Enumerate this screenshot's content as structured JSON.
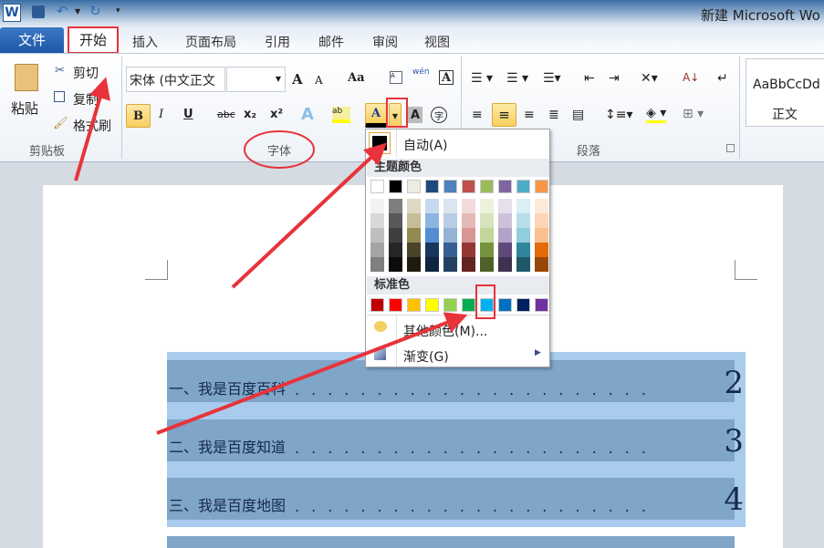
{
  "window": {
    "title": "新建 Microsoft Wo"
  },
  "qat": {
    "app_icon": "W"
  },
  "tabs": [
    {
      "label": "文件"
    },
    {
      "label": "开始"
    },
    {
      "label": "插入"
    },
    {
      "label": "页面布局"
    },
    {
      "label": "引用"
    },
    {
      "label": "邮件"
    },
    {
      "label": "审阅"
    },
    {
      "label": "视图"
    }
  ],
  "clipboard": {
    "paste": "粘贴",
    "cut": "剪切",
    "copy": "复制",
    "format_painter": "格式刷",
    "group": "剪贴板"
  },
  "font": {
    "name": "宋体 (中文正文",
    "size": "",
    "group": "字体",
    "bold": "B",
    "italic": "I",
    "underline": "U",
    "strike": "abc",
    "sub": "x₂",
    "sup": "x²",
    "grow": "A",
    "shrink": "A",
    "case": "Aa",
    "color_a": "A",
    "shade_a": "A",
    "enclose": "字",
    "phonetic": "wén",
    "border_a": "A"
  },
  "paragraph": {
    "group": "段落"
  },
  "styles": {
    "preview": "AaBbCcDd",
    "name": "正文"
  },
  "color_menu": {
    "auto": "自动(A)",
    "theme_header": "主题颜色",
    "standard_header": "标准色",
    "more": "其他颜色(M)...",
    "gradient": "渐变(G)",
    "theme_top": [
      "#ffffff",
      "#000000",
      "#eeece1",
      "#1f497d",
      "#4f81bd",
      "#c0504d",
      "#9bbb59",
      "#8064a2",
      "#4bacc6",
      "#f79646"
    ],
    "theme_shades": [
      [
        "#f2f2f2",
        "#7f7f7f",
        "#ddd9c3",
        "#c6d9f0",
        "#dbe5f1",
        "#f2dcdb",
        "#ebf1dd",
        "#e5e0ec",
        "#dbeef3",
        "#fdeada"
      ],
      [
        "#d8d8d8",
        "#595959",
        "#c4bd97",
        "#8db3e2",
        "#b8cce4",
        "#e5b9b7",
        "#d7e3bc",
        "#ccc1d9",
        "#b7dde8",
        "#fbd5b5"
      ],
      [
        "#bfbfbf",
        "#3f3f3f",
        "#938953",
        "#548dd4",
        "#95b3d7",
        "#d99694",
        "#c3d69b",
        "#b2a2c7",
        "#92cddc",
        "#fac08f"
      ],
      [
        "#a5a5a5",
        "#262626",
        "#494429",
        "#17365d",
        "#366092",
        "#953734",
        "#76923c",
        "#5f497a",
        "#31859b",
        "#e36c09"
      ],
      [
        "#7f7f7f",
        "#0c0c0c",
        "#1d1b10",
        "#0f243e",
        "#244061",
        "#632423",
        "#4f6128",
        "#3f3151",
        "#205867",
        "#974806"
      ]
    ],
    "standard": [
      "#c00000",
      "#ff0000",
      "#ffc000",
      "#ffff00",
      "#92d050",
      "#00b050",
      "#00b0f0",
      "#0070c0",
      "#002060",
      "#7030a0"
    ]
  },
  "document": {
    "toc": [
      {
        "text": "一、我是百度百科",
        "page": "2"
      },
      {
        "text": "二、我是百度知道",
        "page": "3"
      },
      {
        "text": "三、我是百度地图",
        "page": "4"
      }
    ],
    "leader": "......................"
  },
  "colors": {
    "annotation": "#e8333a",
    "selection": "#a8cbee",
    "selection_row": "#7fa5c9"
  }
}
